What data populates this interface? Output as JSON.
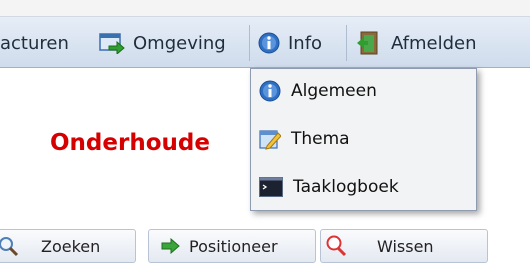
{
  "menubar": {
    "items": [
      {
        "label": "acturen"
      },
      {
        "label": "Omgeving",
        "icon": "environment-arrow-icon"
      },
      {
        "label": "Info",
        "icon": "info-icon"
      },
      {
        "label": "Afmelden",
        "icon": "logout-door-icon"
      }
    ]
  },
  "info_menu": {
    "items": [
      {
        "label": "Algemeen",
        "icon": "info-icon"
      },
      {
        "label": "Thema",
        "icon": "theme-edit-icon"
      },
      {
        "label": "Taaklogboek",
        "icon": "terminal-icon"
      }
    ]
  },
  "page": {
    "title": "Onderhoude"
  },
  "buttons": [
    {
      "label": "Zoeken",
      "icon": "search-icon"
    },
    {
      "label": "Positioneer",
      "icon": "arrow-right-icon"
    },
    {
      "label": "Wissen",
      "icon": "clear-search-icon"
    }
  ],
  "colors": {
    "title": "#d60000",
    "menubar": "#dbe4f0"
  }
}
